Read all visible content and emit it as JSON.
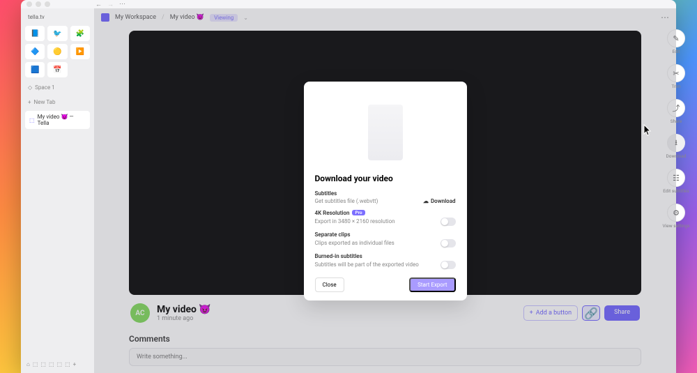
{
  "browser": {
    "address": "tella.tv",
    "space_label": "Space 1",
    "new_tab_label": "New Tab",
    "active_tab": "My video 😈 — Tella"
  },
  "header": {
    "workspace": "My Workspace",
    "video_name": "My video 😈",
    "mode_badge": "Viewing"
  },
  "meta": {
    "avatar_initials": "AC",
    "title": "My video 😈",
    "timestamp": "1 minute ago",
    "add_button": "Add a button",
    "share": "Share"
  },
  "comments": {
    "heading": "Comments",
    "placeholder": "Write something..."
  },
  "rail": {
    "edit": "Edit",
    "trim": "Trim",
    "share": "Share",
    "download": "Download",
    "subtitles": "Edit subtitles",
    "settings": "View settings"
  },
  "modal": {
    "title": "Download your video",
    "subtitles_label": "Subtitles",
    "subtitles_desc": "Get subtitles file (.webvtt)",
    "subtitles_action": "Download",
    "res_label": "4K Resolution",
    "res_badge": "Pro",
    "res_desc": "Export in 3480 × 2160 resolution",
    "clips_label": "Separate clips",
    "clips_desc": "Clips exported as individual files",
    "burn_label": "Burned-in subtitles",
    "burn_desc": "Subtitles will be part of the exported video",
    "close": "Close",
    "start": "Start Export"
  },
  "icons": {
    "tile1": "📘",
    "tile2": "🐦",
    "tile3": "🧩",
    "tile4": "🔷",
    "tile5": "🟡",
    "tile6": "▶️",
    "tile7": "🟦",
    "tile8": "📅"
  }
}
